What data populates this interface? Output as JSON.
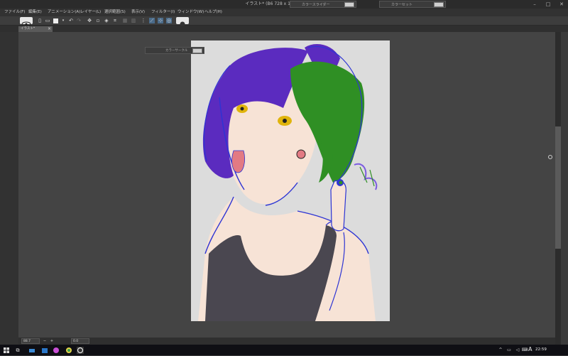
{
  "window": {
    "title": "イラスト* (B6 728 x 1032px 144dpi )",
    "controls": {
      "minimize": "–",
      "maximize": "□",
      "close": "✕"
    }
  },
  "floating_tabs": [
    "カラースライダー",
    "カラーセット"
  ],
  "menu": [
    "ファイル(F)",
    "編集(E)",
    "アニメーション(A)",
    "レイヤー(L)",
    "選択範囲(S)",
    "表示(V)",
    "フィルター(I)",
    "ウィンドウ(W)",
    "ヘルプ(H)"
  ],
  "document_tab": {
    "label": "イラスト*",
    "close": "×"
  },
  "floating_palette": {
    "label": "カラーサークル"
  },
  "status": {
    "zoom": "88.7",
    "angle": "0.0"
  },
  "taskbar": {
    "time": "22:59",
    "ime": "A",
    "icons": [
      "windows-logo-icon",
      "task-view-icon",
      "explorer-icon",
      "store-icon",
      "app-icon-1",
      "app-icon-2",
      "clip-studio-icon"
    ]
  },
  "colors": {
    "hair_purple": "#5b2bbf",
    "hair_green": "#2f8f24",
    "line_blue": "#2d34d4",
    "skin": "#f7e3d6",
    "shirt_dark": "#4a4750",
    "eye_yellow": "#e0b40c",
    "tongue": "#e27a83"
  }
}
